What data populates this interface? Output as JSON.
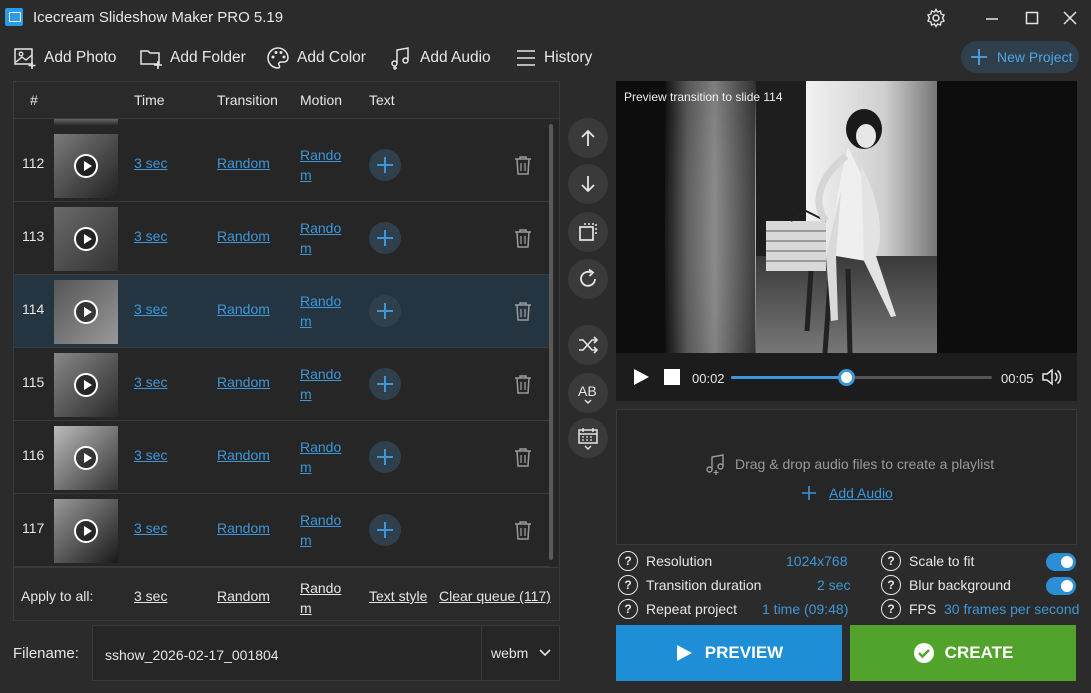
{
  "app": {
    "title": "Icecream Slideshow Maker PRO 5.19"
  },
  "toolbar": {
    "add_photo": "Add Photo",
    "add_folder": "Add Folder",
    "add_color": "Add Color",
    "add_audio": "Add Audio",
    "history": "History",
    "new_project": "New Project"
  },
  "table": {
    "headers": {
      "num": "#",
      "time": "Time",
      "transition": "Transition",
      "motion": "Motion",
      "text": "Text"
    },
    "rows": [
      {
        "num": "112",
        "time": "3 sec",
        "transition": "Random",
        "motion": "Random"
      },
      {
        "num": "113",
        "time": "3 sec",
        "transition": "Random",
        "motion": "Random"
      },
      {
        "num": "114",
        "time": "3 sec",
        "transition": "Random",
        "motion": "Random",
        "selected": true
      },
      {
        "num": "115",
        "time": "3 sec",
        "transition": "Random",
        "motion": "Random"
      },
      {
        "num": "116",
        "time": "3 sec",
        "transition": "Random",
        "motion": "Random"
      },
      {
        "num": "117",
        "time": "3 sec",
        "transition": "Random",
        "motion": "Random"
      }
    ],
    "apply_all": {
      "label": "Apply to all:",
      "time": "3 sec",
      "transition": "Random",
      "motion": "Random",
      "text_style": "Text style",
      "clear_queue": "Clear queue (117)"
    }
  },
  "filename": {
    "label": "Filename:",
    "value": "sshow_2026-02-17_001804",
    "format": "webm"
  },
  "preview": {
    "title": "Preview transition to slide 114",
    "current_time": "00:02",
    "total_time": "00:05",
    "progress": 0.44
  },
  "audio": {
    "drop_text": "Drag & drop audio files to create a playlist",
    "add_audio": "Add Audio"
  },
  "settings": {
    "resolution_label": "Resolution",
    "resolution_value": "1024x768",
    "transition_label": "Transition duration",
    "transition_value": "2 sec",
    "repeat_label": "Repeat project",
    "repeat_value": "1 time (09:48)",
    "scale_label": "Scale to fit",
    "scale_on": true,
    "blur_label": "Blur background",
    "blur_on": true,
    "fps_label": "FPS",
    "fps_value": "30 frames per second"
  },
  "buttons": {
    "preview": "PREVIEW",
    "create": "CREATE"
  },
  "colors": {
    "accent": "#3d97d8",
    "preview_btn": "#1e8ed6",
    "create_btn": "#52a32b",
    "bg": "#2b2b2b"
  }
}
